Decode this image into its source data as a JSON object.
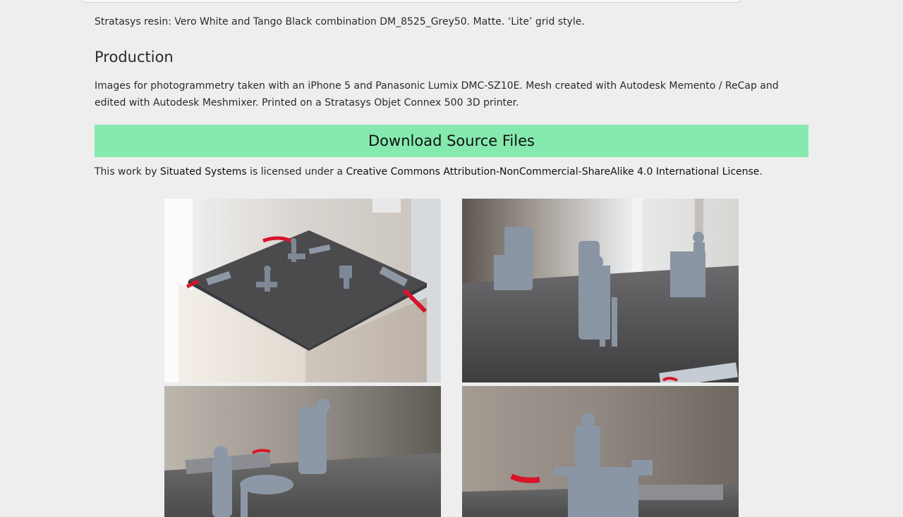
{
  "resin_text": "Stratasys resin: Vero White and Tango Black combination DM_8525_Grey50. Matte. ‘Lite’ grid style.",
  "production": {
    "heading": "Production",
    "body": "Images for photogrammetry taken with an iPhone 5 and Panasonic Lumix DMC-SZ10E. Mesh created with Autodesk Memento / ReCap and edited with Autodesk Meshmixer. Printed on a Stratasys Objet Connex 500 3D printer."
  },
  "download": {
    "label": "Download Source Files",
    "color": "#86e9ae"
  },
  "license": {
    "prefix": "This work by ",
    "author_link": "Situated Systems",
    "middle": " is licensed under a ",
    "license_link": "Creative Commons Attribution-NonCommercial-ShareAlike 4.0 International License",
    "suffix": "."
  },
  "gallery": {
    "photos": [
      {
        "name": "photo-plinth-overview"
      },
      {
        "name": "photo-figure-at-machine"
      },
      {
        "name": "photo-figure-sawing"
      },
      {
        "name": "photo-figure-behind-machine"
      }
    ]
  }
}
